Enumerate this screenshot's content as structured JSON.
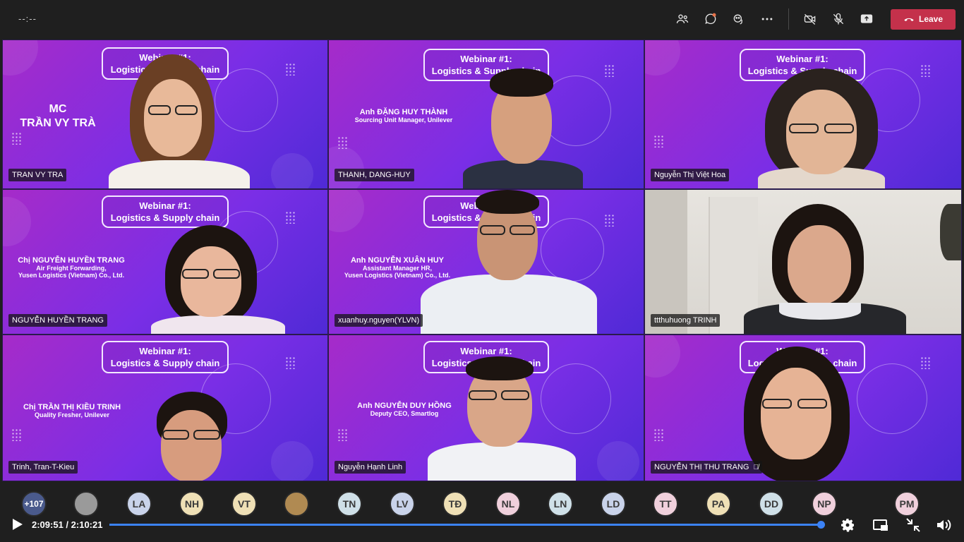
{
  "topbar": {
    "timer": "--:--",
    "leave_label": "Leave"
  },
  "webinar_banner": {
    "line1": "Webinar #1:",
    "line2": "Logistics & Supply chain"
  },
  "tiles": [
    {
      "participant": "TRAN VY TRA",
      "mc_line1": "MC",
      "mc_line2": "TRẦN VY TRÀ",
      "speaker_name": "",
      "speaker_role_1": "",
      "speaker_role_2": "",
      "background": "webinar",
      "muted": false
    },
    {
      "participant": "THANH, DANG-HUY",
      "speaker_name": "Anh ĐẶNG HUY THÀNH",
      "speaker_role_1": "Sourcing Unit Manager, Unilever",
      "speaker_role_2": "",
      "background": "webinar",
      "muted": false
    },
    {
      "participant": "Nguyễn Thị Việt Hoa",
      "speaker_name": "",
      "speaker_role_1": "",
      "speaker_role_2": "",
      "background": "webinar",
      "muted": false
    },
    {
      "participant": "NGUYỄN HUYỀN TRANG",
      "speaker_name": "Chị NGUYỄN HUYỀN TRANG",
      "speaker_role_1": "Air Freight Forwarding,",
      "speaker_role_2": "Yusen Logistics (Vietnam) Co., Ltd.",
      "background": "webinar",
      "muted": false
    },
    {
      "participant": "xuanhuy.nguyen(YLVN)",
      "speaker_name": "Anh NGUYỄN XUÂN HUY",
      "speaker_role_1": "Assistant Manager HR,",
      "speaker_role_2": "Yusen Logistics (Vietnam) Co., Ltd.",
      "background": "webinar",
      "muted": false
    },
    {
      "participant": "ttthuhuong TRINH",
      "speaker_name": "",
      "speaker_role_1": "",
      "speaker_role_2": "",
      "background": "room",
      "muted": false
    },
    {
      "participant": "Trinh, Tran-T-Kieu",
      "speaker_name": "Chị TRẦN THỊ KIỀU TRINH",
      "speaker_role_1": "Quality Fresher, Unilever",
      "speaker_role_2": "",
      "background": "webinar",
      "muted": false
    },
    {
      "participant": "Nguyễn Hạnh Linh",
      "speaker_name": "Anh NGUYỄN DUY HỒNG",
      "speaker_role_1": "Deputy CEO, Smartlog",
      "speaker_role_2": "",
      "background": "webinar",
      "muted": false
    },
    {
      "participant": "NGUYỄN THỊ THU TRANG",
      "speaker_name": "",
      "speaker_role_1": "",
      "speaker_role_2": "",
      "background": "webinar",
      "muted": true
    }
  ],
  "participants_bar": {
    "overflow": "+107",
    "avatars": [
      {
        "initials": "",
        "color": "#9a9a9a",
        "photo": true
      },
      {
        "initials": "LA",
        "color": "#c9d3ea"
      },
      {
        "initials": "NH",
        "color": "#efe0b6"
      },
      {
        "initials": "VT",
        "color": "#efe0b6"
      },
      {
        "initials": "",
        "color": "#b08a52",
        "photo": true
      },
      {
        "initials": "TN",
        "color": "#cfe0e8"
      },
      {
        "initials": "LV",
        "color": "#c9d3ea"
      },
      {
        "initials": "TĐ",
        "color": "#efe0b6"
      },
      {
        "initials": "NL",
        "color": "#f0d0dc"
      },
      {
        "initials": "LN",
        "color": "#cfe0e8"
      },
      {
        "initials": "LD",
        "color": "#c9d3ea"
      },
      {
        "initials": "TT",
        "color": "#f0d0dc"
      },
      {
        "initials": "PA",
        "color": "#efe0b6"
      },
      {
        "initials": "DD",
        "color": "#cfe0e8"
      },
      {
        "initials": "NP",
        "color": "#f0d0dc"
      },
      {
        "initials": "PM",
        "color": "#f0d0dc"
      }
    ]
  },
  "player": {
    "current_time": "2:09:51",
    "separator": " / ",
    "total_time": "2:10:21",
    "progress_fraction": 0.9977
  },
  "colors": {
    "leave_red": "#c4314b",
    "progress_blue": "#3b82f6",
    "tile_purple": "#7a2ee6"
  }
}
